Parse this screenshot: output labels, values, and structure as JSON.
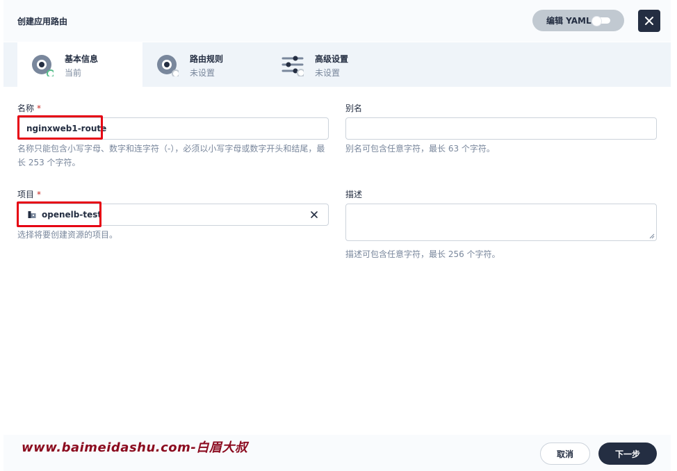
{
  "header": {
    "title": "创建应用路由",
    "yaml_label": "编辑 YAML",
    "close_icon": "close-icon"
  },
  "steps": [
    {
      "title": "基本信息",
      "status": "当前",
      "icon": "radio-dot-icon"
    },
    {
      "title": "路由规则",
      "status": "未设置",
      "icon": "radio-dot-icon"
    },
    {
      "title": "高级设置",
      "status": "未设置",
      "icon": "sliders-icon"
    }
  ],
  "form": {
    "name": {
      "label": "名称",
      "required_mark": "*",
      "value": "nginxweb1-route",
      "hint": "名称只能包含小写字母、数字和连字符（-），必须以小写字母或数字开头和结尾，最长 253 个字符。",
      "hint_line1": "名称只能包含小写字母、数字和连字符（-），必须以小写字母或数字开头和结尾，最",
      "hint_line2": "长 253 个字符。"
    },
    "alias": {
      "label": "别名",
      "value": "",
      "hint": "别名可包含任意字符，最长 63 个字符。"
    },
    "project": {
      "label": "项目",
      "required_mark": "*",
      "value": "openelb-test",
      "icon": "project-icon",
      "hint": "选择将要创建资源的项目。"
    },
    "description": {
      "label": "描述",
      "value": "",
      "hint": "描述可包含任意字符，最长 256 个字符。"
    }
  },
  "footer": {
    "watermark": "www.baimeidashu.com-白眉大叔",
    "cancel_label": "取消",
    "next_label": "下一步"
  },
  "colors": {
    "primary_dark": "#242e42",
    "required_red": "#ca2621",
    "highlight_red": "#e60012",
    "step_done_green": "#55bc8a",
    "watermark": "#8b0b1f"
  }
}
